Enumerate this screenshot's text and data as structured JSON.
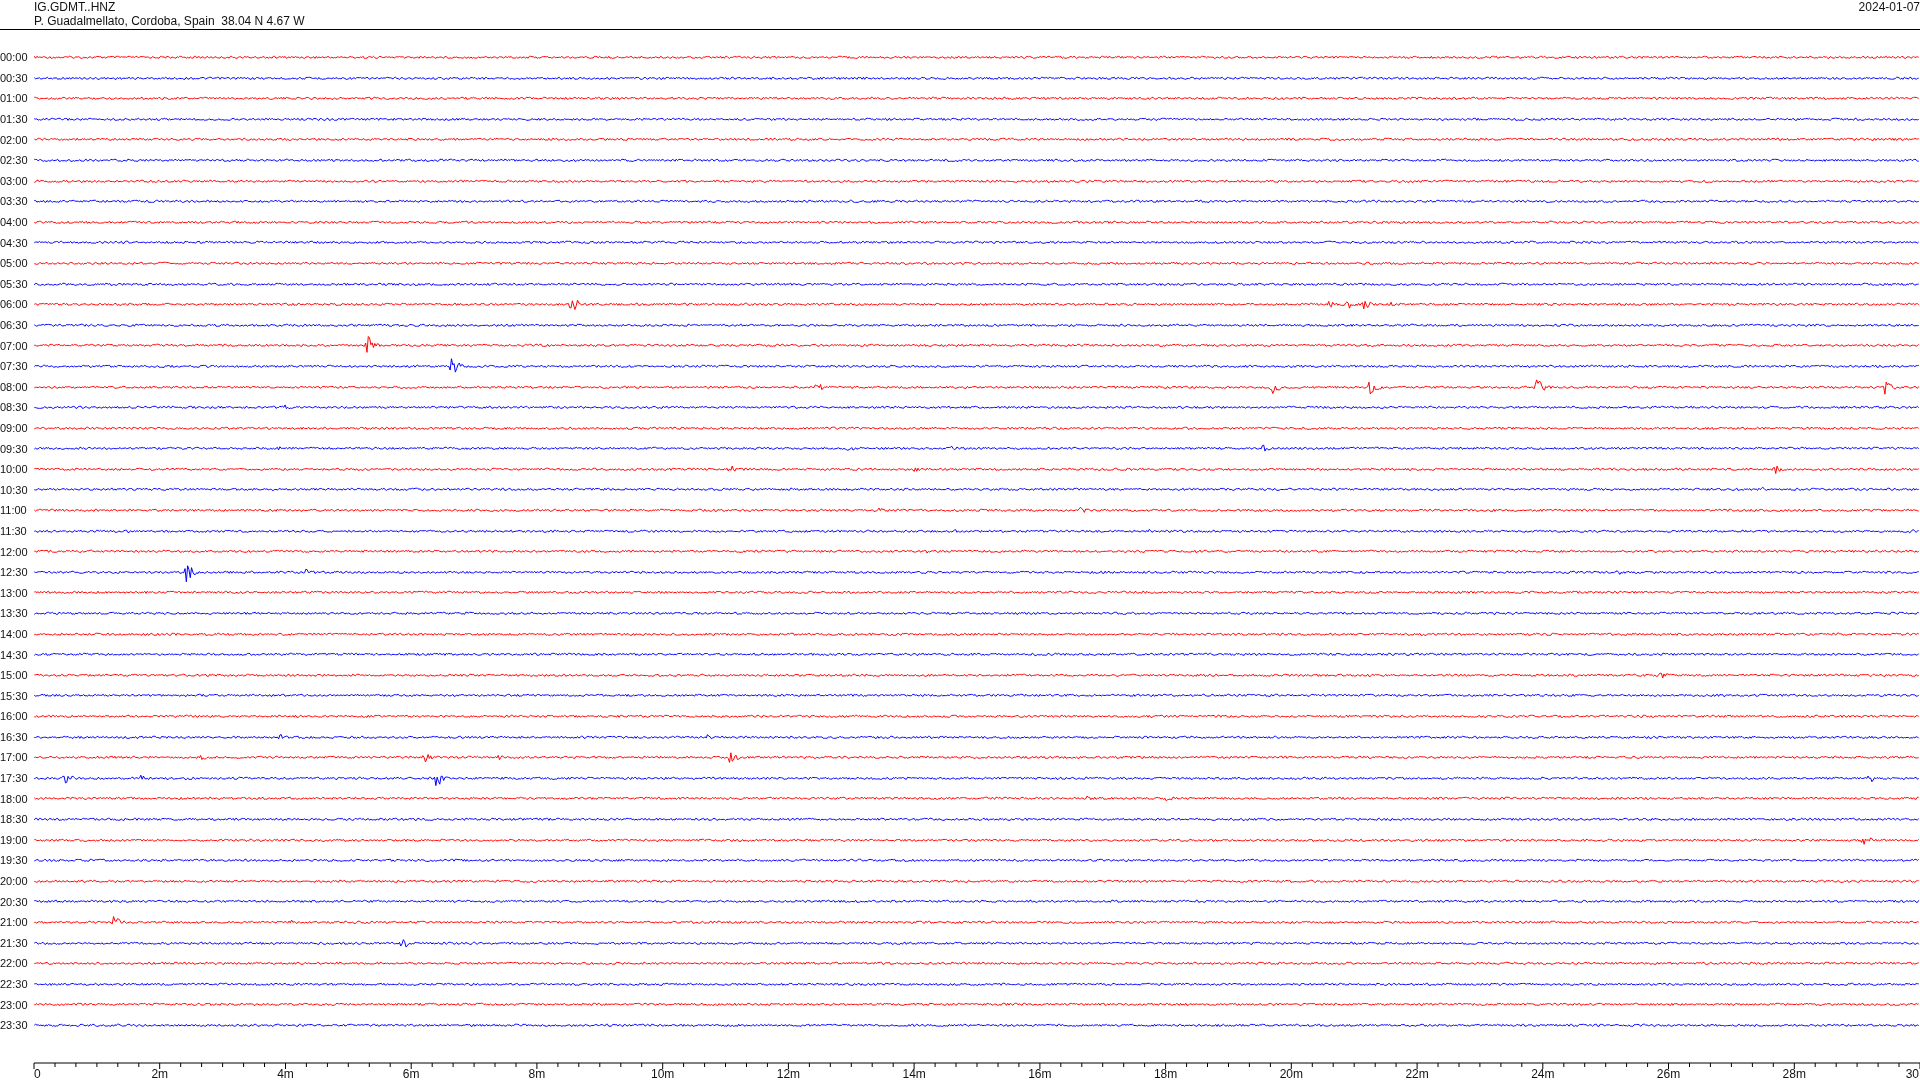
{
  "header": {
    "station": "IG.GDMT..HNZ",
    "location": "P. Guadalmellato, Cordoba, Spain  38.04 N 4.67 W",
    "date": "2024-01-07"
  },
  "traces": [
    {
      "label": "00:00",
      "color": "#ff0000"
    },
    {
      "label": "00:30",
      "color": "#0000ff"
    },
    {
      "label": "01:00",
      "color": "#ff0000"
    },
    {
      "label": "01:30",
      "color": "#0000ff"
    },
    {
      "label": "02:00",
      "color": "#ff0000"
    },
    {
      "label": "02:30",
      "color": "#0000ff"
    },
    {
      "label": "03:00",
      "color": "#ff0000"
    },
    {
      "label": "03:30",
      "color": "#0000ff"
    },
    {
      "label": "04:00",
      "color": "#ff0000"
    },
    {
      "label": "04:30",
      "color": "#0000ff"
    },
    {
      "label": "05:00",
      "color": "#ff0000"
    },
    {
      "label": "05:30",
      "color": "#0000ff"
    },
    {
      "label": "06:00",
      "color": "#ff0000"
    },
    {
      "label": "06:30",
      "color": "#0000ff"
    },
    {
      "label": "07:00",
      "color": "#ff0000"
    },
    {
      "label": "07:30",
      "color": "#0000ff"
    },
    {
      "label": "08:00",
      "color": "#ff0000"
    },
    {
      "label": "08:30",
      "color": "#0000ff"
    },
    {
      "label": "09:00",
      "color": "#ff0000"
    },
    {
      "label": "09:30",
      "color": "#0000ff"
    },
    {
      "label": "10:00",
      "color": "#ff0000"
    },
    {
      "label": "10:30",
      "color": "#0000ff"
    },
    {
      "label": "11:00",
      "color": "#ff0000"
    },
    {
      "label": "11:30",
      "color": "#0000ff"
    },
    {
      "label": "12:00",
      "color": "#ff0000"
    },
    {
      "label": "12:30",
      "color": "#0000ff"
    },
    {
      "label": "13:00",
      "color": "#ff0000"
    },
    {
      "label": "13:30",
      "color": "#0000ff"
    },
    {
      "label": "14:00",
      "color": "#ff0000"
    },
    {
      "label": "14:30",
      "color": "#0000ff"
    },
    {
      "label": "15:00",
      "color": "#ff0000"
    },
    {
      "label": "15:30",
      "color": "#0000ff"
    },
    {
      "label": "16:00",
      "color": "#ff0000"
    },
    {
      "label": "16:30",
      "color": "#0000ff"
    },
    {
      "label": "17:00",
      "color": "#ff0000"
    },
    {
      "label": "17:30",
      "color": "#0000ff"
    },
    {
      "label": "18:00",
      "color": "#ff0000"
    },
    {
      "label": "18:30",
      "color": "#0000ff"
    },
    {
      "label": "19:00",
      "color": "#ff0000"
    },
    {
      "label": "19:30",
      "color": "#0000ff"
    },
    {
      "label": "20:00",
      "color": "#ff0000"
    },
    {
      "label": "20:30",
      "color": "#0000ff"
    },
    {
      "label": "21:00",
      "color": "#ff0000"
    },
    {
      "label": "21:30",
      "color": "#0000ff"
    },
    {
      "label": "22:00",
      "color": "#ff0000"
    },
    {
      "label": "22:30",
      "color": "#0000ff"
    },
    {
      "label": "23:00",
      "color": "#ff0000"
    },
    {
      "label": "23:30",
      "color": "#0000ff"
    }
  ],
  "axis": {
    "labels": [
      "0",
      "2m",
      "4m",
      "6m",
      "8m",
      "10m",
      "12m",
      "14m",
      "16m",
      "18m",
      "20m",
      "22m",
      "24m",
      "26m",
      "28m",
      "30"
    ]
  }
}
